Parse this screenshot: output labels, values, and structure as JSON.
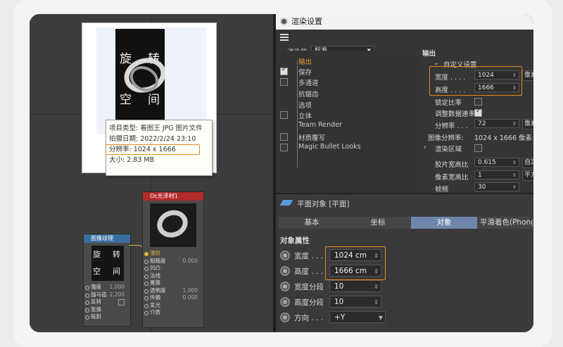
{
  "preview": {
    "poster_chars": [
      "旋",
      "转",
      "空",
      "间"
    ],
    "tooltip": {
      "type_line": "项目类型: 看图王 JPG 图片文件",
      "date_line": "拍摄日期: 2022/2/24 23:10",
      "resolution_line": "分辨率: 1024 x 1666",
      "size_line": "大小: 2.83 MB"
    }
  },
  "nodes": {
    "image_texture": {
      "title": "图像纹理",
      "poster_chars": [
        "旋",
        "转",
        "空",
        "间"
      ],
      "rows": [
        {
          "label": "强度",
          "value": "1.000"
        },
        {
          "label": "伽马值",
          "value": "2.200"
        },
        {
          "label": "反转",
          "value": ""
        },
        {
          "label": "变换",
          "value": ""
        },
        {
          "label": "投射",
          "value": ""
        }
      ]
    },
    "oc_glossy": {
      "title": "Oc光泽材1",
      "output_label": "漫射",
      "rows": [
        {
          "label": "粗糙度",
          "value": "0.000"
        },
        {
          "label": "凹凸",
          "value": ""
        },
        {
          "label": "法线",
          "value": ""
        },
        {
          "label": "置换",
          "value": ""
        },
        {
          "label": "透明度",
          "value": "1.000"
        },
        {
          "label": "传输",
          "value": "0.000"
        },
        {
          "label": "发光",
          "value": ""
        },
        {
          "label": "介质",
          "value": ""
        }
      ]
    }
  },
  "render_settings": {
    "window_title": "渲染设置",
    "renderer_label": "渲染器",
    "renderer_value": "标准",
    "tree_items": [
      "输出",
      "保存",
      "多通道",
      "抗锯齿",
      "选项",
      "立体",
      "Team Render",
      "材质覆写",
      "Magic Bullet Looks"
    ],
    "output_heading": "输出",
    "preset_value": "自定义设置",
    "width_label": "宽度",
    "width_value": "1024",
    "height_label": "高度",
    "height_value": "1666",
    "unit_value": "像素",
    "lock_ratio_label": "锁定比率",
    "adjust_rate_label": "调整数据速率",
    "resolution_label": "分辨率",
    "resolution_value": "72",
    "resolution_unit": "像素",
    "image_resolution_label": "图像分辨率:",
    "image_resolution_value": "1024 x 1666 像素",
    "render_region_label": "渲染区域",
    "film_ratio_label": "胶片宽高比",
    "film_ratio_value": "0.615",
    "film_ratio_select": "自定",
    "pixel_ratio_label": "像素宽高比",
    "pixel_ratio_value": "1",
    "pixel_ratio_select": "平方",
    "fps_label": "帧频",
    "fps_value": "30"
  },
  "plane_object": {
    "title": "平面对象 [平面]",
    "tabs": [
      "基本",
      "坐标",
      "对象",
      "平滑着色(Phong"
    ],
    "active_tab": "对象",
    "section_title": "对象属性",
    "fields": [
      {
        "label": "宽度",
        "value": "1024 cm"
      },
      {
        "label": "高度",
        "value": "1666 cm"
      },
      {
        "label": "宽度分段",
        "value": "10"
      },
      {
        "label": "高度分段",
        "value": "10"
      },
      {
        "label": "方向",
        "value": "+Y"
      }
    ]
  },
  "colors": {
    "accent": "#e08a1e",
    "active_tab": "#6f87ad"
  }
}
